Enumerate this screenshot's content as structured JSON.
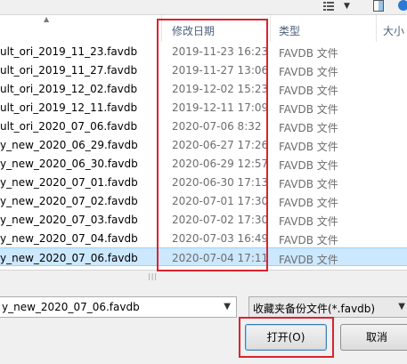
{
  "toolbar": {
    "icons": [
      "view-options-icon",
      "chevron-down-icon",
      "preview-pane-icon",
      "help-icon"
    ]
  },
  "columns": {
    "date": "修改日期",
    "type": "类型",
    "size": "大小"
  },
  "files": [
    {
      "name": "ult_ori_2019_11_23.favdb",
      "date": "2019-11-23 16:23",
      "type": "FAVDB 文件"
    },
    {
      "name": "ult_ori_2019_11_27.favdb",
      "date": "2019-11-27 13:06",
      "type": "FAVDB 文件"
    },
    {
      "name": "ult_ori_2019_12_02.favdb",
      "date": "2019-12-02 15:23",
      "type": "FAVDB 文件"
    },
    {
      "name": "ult_ori_2019_12_11.favdb",
      "date": "2019-12-11 17:09",
      "type": "FAVDB 文件"
    },
    {
      "name": "ult_ori_2020_07_06.favdb",
      "date": "2020-07-06 8:32",
      "type": "FAVDB 文件"
    },
    {
      "name": "y_new_2020_06_29.favdb",
      "date": "2020-06-27 17:26",
      "type": "FAVDB 文件"
    },
    {
      "name": "y_new_2020_06_30.favdb",
      "date": "2020-06-29 12:57",
      "type": "FAVDB 文件"
    },
    {
      "name": "y_new_2020_07_01.favdb",
      "date": "2020-06-30 17:13",
      "type": "FAVDB 文件"
    },
    {
      "name": "y_new_2020_07_02.favdb",
      "date": "2020-07-01 17:30",
      "type": "FAVDB 文件"
    },
    {
      "name": "y_new_2020_07_03.favdb",
      "date": "2020-07-02 17:30",
      "type": "FAVDB 文件"
    },
    {
      "name": "y_new_2020_07_04.favdb",
      "date": "2020-07-03 16:49",
      "type": "FAVDB 文件"
    },
    {
      "name": "y_new_2020_07_06.favdb",
      "date": "2020-07-04 17:11",
      "type": "FAVDB 文件",
      "selected": true
    }
  ],
  "filename": {
    "value": "y_new_2020_07_06.favdb"
  },
  "filter": {
    "value": "收藏夹备份文件(*.favdb)"
  },
  "buttons": {
    "open": "打开(O)",
    "cancel": "取消"
  },
  "colors": {
    "highlight": "#d9232e",
    "selection": "#cce8ff",
    "header_text": "#4c607a"
  }
}
